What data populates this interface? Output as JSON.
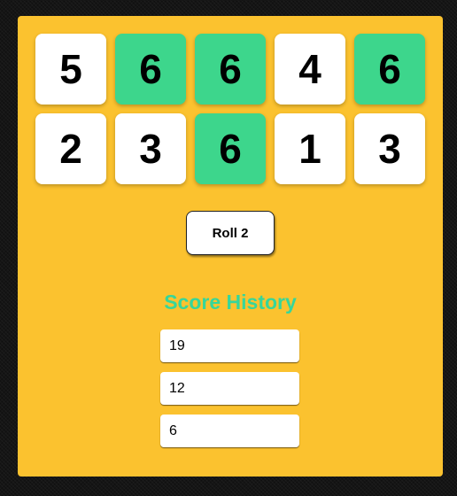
{
  "dice": [
    {
      "value": "5",
      "held": false
    },
    {
      "value": "6",
      "held": true
    },
    {
      "value": "6",
      "held": true
    },
    {
      "value": "4",
      "held": false
    },
    {
      "value": "6",
      "held": true
    },
    {
      "value": "2",
      "held": false
    },
    {
      "value": "3",
      "held": false
    },
    {
      "value": "6",
      "held": true
    },
    {
      "value": "1",
      "held": false
    },
    {
      "value": "3",
      "held": false
    }
  ],
  "roll_button_label": "Roll 2",
  "history": {
    "title": "Score History",
    "scores": [
      "19",
      "12",
      "6"
    ]
  },
  "colors": {
    "board": "#fbc22f",
    "held_die": "#3dd68c",
    "die": "#ffffff",
    "history_title": "#36d69a"
  }
}
